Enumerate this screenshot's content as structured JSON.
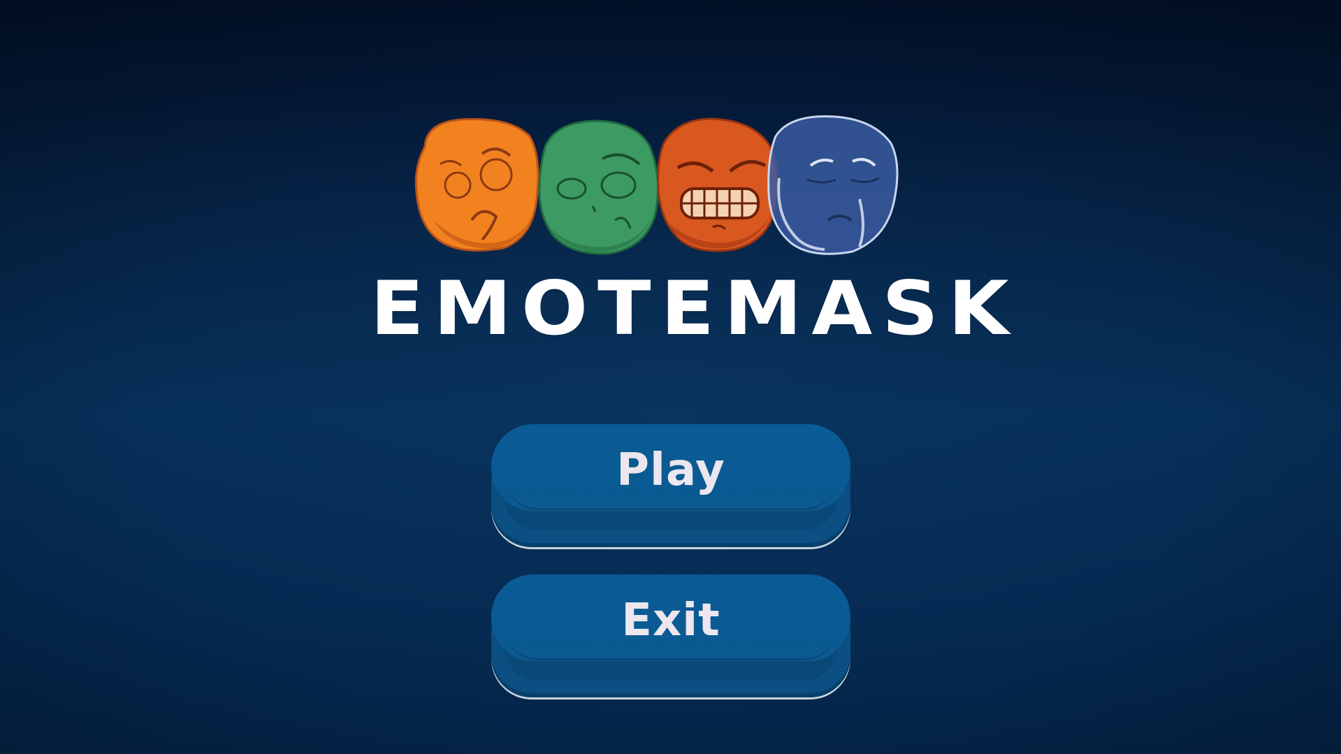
{
  "game": {
    "title": "EMOTEMASK"
  },
  "logo": {
    "masks": [
      {
        "emotion": "anxious",
        "color": "#f2821f"
      },
      {
        "emotion": "disgusted",
        "color": "#3d9a62"
      },
      {
        "emotion": "angry",
        "color": "#d9581f"
      },
      {
        "emotion": "sad",
        "color": "#3a5aa0"
      }
    ]
  },
  "menu": {
    "play_label": "Play",
    "exit_label": "Exit"
  },
  "colors": {
    "background_top": "#02112a",
    "background_bottom": "#042447",
    "button": "#0a5b96",
    "button_text": "#ece6ee"
  }
}
